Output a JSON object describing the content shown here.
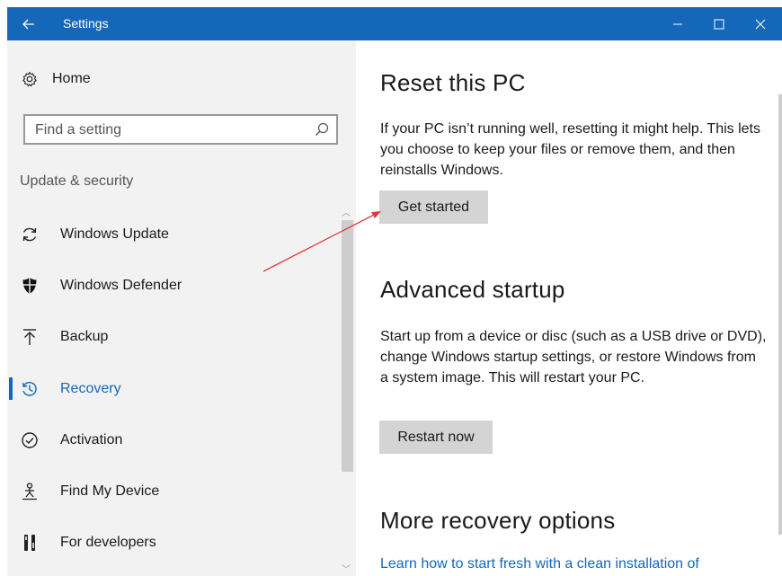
{
  "window": {
    "title": "Settings",
    "controls": {
      "minimize": "—",
      "maximize": "☐",
      "close": "✕"
    }
  },
  "sidebar": {
    "home_label": "Home",
    "search": {
      "placeholder": "Find a setting"
    },
    "group_label": "Update & security",
    "items": [
      {
        "label": "Windows Update",
        "icon": "sync-icon",
        "active": false
      },
      {
        "label": "Windows Defender",
        "icon": "shield-icon",
        "active": false
      },
      {
        "label": "Backup",
        "icon": "upload-icon",
        "active": false
      },
      {
        "label": "Recovery",
        "icon": "history-icon",
        "active": true
      },
      {
        "label": "Activation",
        "icon": "check-circle-icon",
        "active": false
      },
      {
        "label": "Find My Device",
        "icon": "person-location-icon",
        "active": false
      },
      {
        "label": "For developers",
        "icon": "developer-tools-icon",
        "active": false
      }
    ]
  },
  "main": {
    "reset": {
      "title": "Reset this PC",
      "description": "If your PC isn’t running well, resetting it might help. This lets you choose to keep your files or remove them, and then reinstalls Windows.",
      "button": "Get started"
    },
    "advanced": {
      "title": "Advanced startup",
      "description": "Start up from a device or disc (such as a USB drive or DVD), change Windows startup settings, or restore Windows from a system image. This will restart your PC.",
      "button": "Restart now"
    },
    "more": {
      "title": "More recovery options",
      "link": "Learn how to start fresh with a clean installation of"
    }
  },
  "colors": {
    "accent": "#1567b9",
    "sidebar_bg": "#f2f2f2",
    "button_bg": "#d4d4d4",
    "annotation_arrow": "#e0393e"
  }
}
